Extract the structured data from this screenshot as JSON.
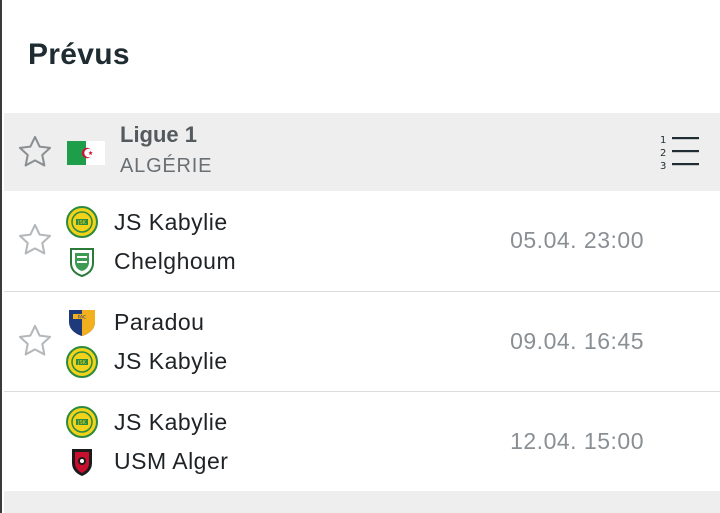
{
  "section_title": "Prévus",
  "league": {
    "name": "Ligue 1",
    "country": "ALGÉRIE",
    "flag_icon": "algeria-flag-icon",
    "flag_colors": {
      "green": "#1e9e4a",
      "white": "#ffffff",
      "red": "#d21034"
    }
  },
  "matches": [
    {
      "home": {
        "name": "JS Kabylie",
        "logo": "js-kabylie-logo-icon"
      },
      "away": {
        "name": "Chelghoum",
        "logo": "chelghoum-logo-icon"
      },
      "time": "05.04. 23:00",
      "favorite_star": true
    },
    {
      "home": {
        "name": "Paradou",
        "logo": "paradou-logo-icon"
      },
      "away": {
        "name": "JS Kabylie",
        "logo": "js-kabylie-logo-icon"
      },
      "time": "09.04. 16:45",
      "favorite_star": true
    },
    {
      "home": {
        "name": "JS Kabylie",
        "logo": "js-kabylie-logo-icon"
      },
      "away": {
        "name": "USM Alger",
        "logo": "usm-alger-logo-icon"
      },
      "time": "12.04. 15:00",
      "favorite_star": false
    }
  ],
  "colors": {
    "header_bg": "#eeeeee",
    "title_text": "#1f2d33",
    "time_text": "#8a8f93",
    "jsk_yellow": "#f2d21b",
    "jsk_green": "#2b8a3e"
  }
}
